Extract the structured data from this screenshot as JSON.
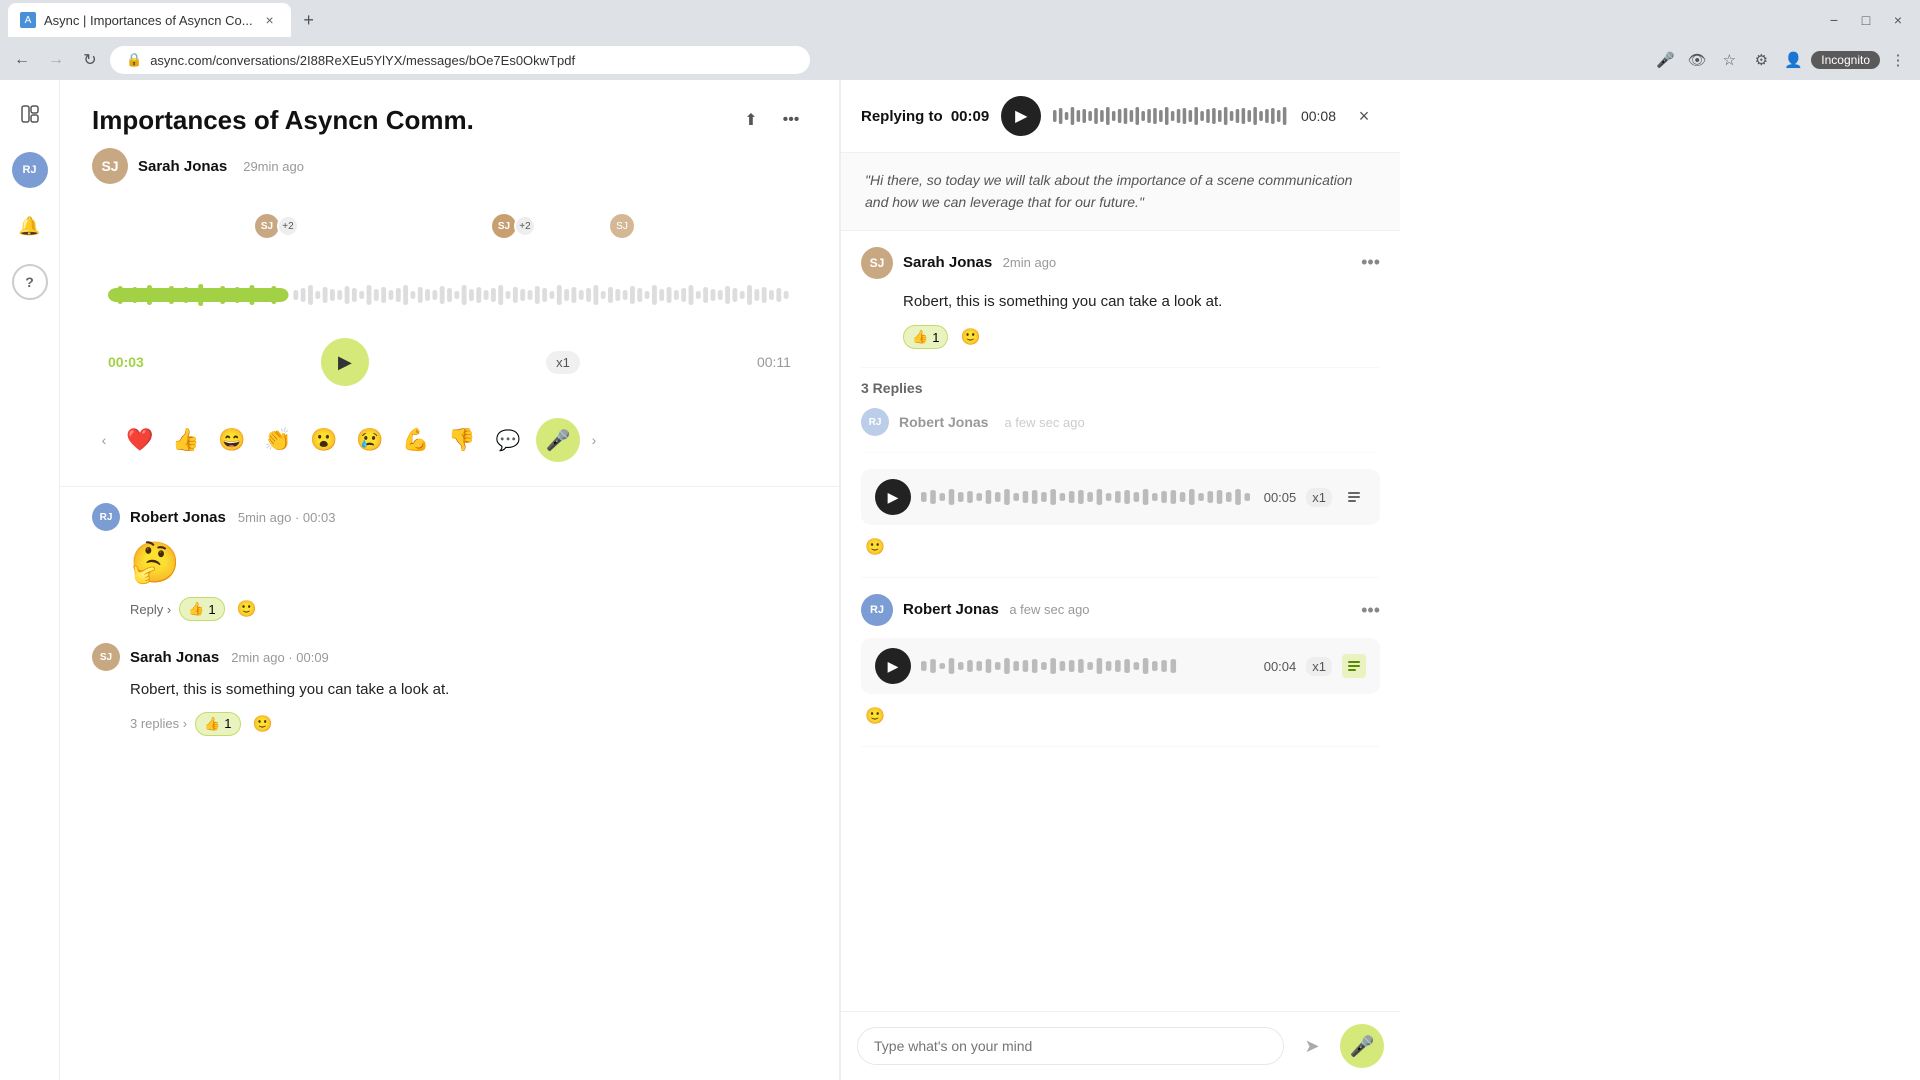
{
  "browser": {
    "tab_title": "Async | Importances of Asyncn Co...",
    "url": "async.com/conversations/2I88ReXEu5YlYX/messages/bOe7Es0OkwTpdf",
    "new_tab_label": "+",
    "close_tab": "×",
    "back": "←",
    "forward": "→",
    "reload": "↻",
    "incognito_label": "Incognito",
    "window_minimize": "−",
    "window_maximize": "□",
    "window_close": "×"
  },
  "sidebar": {
    "icons": [
      {
        "name": "panel-toggle",
        "symbol": "⊞"
      },
      {
        "name": "avatar-rj",
        "symbol": "RJ"
      },
      {
        "name": "bell",
        "symbol": "🔔"
      },
      {
        "name": "help",
        "symbol": "?"
      }
    ]
  },
  "conversation": {
    "title": "Importances of Asyncn Comm.",
    "author": "Sarah Jonas",
    "timestamp": "29min ago",
    "audio": {
      "time_elapsed": "00:03",
      "time_total": "00:11",
      "speed": "x1"
    },
    "emojis": [
      "❤️",
      "👍",
      "😄",
      "👏",
      "😮",
      "😢",
      "💪",
      "👎"
    ],
    "messages": [
      {
        "id": "msg1",
        "author": "Robert Jonas",
        "author_initials": "RJ",
        "timestamp": "5min ago",
        "duration": "00:03",
        "content_type": "emoji",
        "emoji": "🤔",
        "reply_label": "Reply ›",
        "reaction": {
          "emoji": "👍",
          "count": "1"
        },
        "footer_actions": [
          "reply",
          "react",
          "emoji-react"
        ]
      },
      {
        "id": "msg2",
        "author": "Sarah Jonas",
        "author_initials": "SJ",
        "timestamp": "2min ago",
        "duration": "00:09",
        "content_type": "text",
        "text": "Robert, this is something you can take a look at.",
        "replies_count": "3 replies ›",
        "reaction": {
          "emoji": "👍",
          "count": "1"
        },
        "footer_actions": [
          "replies",
          "react",
          "emoji-react"
        ]
      }
    ]
  },
  "reply_panel": {
    "replying_to_label": "Replying to",
    "replying_to_time": "00:09",
    "audio_duration": "00:08",
    "close_btn": "×",
    "quote": "\"Hi there, so today we will talk about the importance of a scene communication and how we can leverage that for our future.\"",
    "comment": {
      "author": "Sarah Jonas",
      "author_initials": "SJ",
      "timestamp": "2min ago",
      "text": "Robert, this is something you can take a look at.",
      "reaction": {
        "emoji": "👍",
        "count": "1"
      }
    },
    "replies_section_label": "3 Replies",
    "replies": [
      {
        "id": "reply1",
        "author": "Robert Jonas",
        "author_initials": "RJ",
        "timestamp": "a few sec ago",
        "audio_duration": "00:05",
        "speed": "x1"
      },
      {
        "id": "reply2",
        "author": "Robert Jonas",
        "author_initials": "RJ",
        "timestamp": "a few sec ago",
        "audio_duration": "00:04",
        "speed": "x1"
      }
    ],
    "input_placeholder": "Type what's on your mind"
  }
}
